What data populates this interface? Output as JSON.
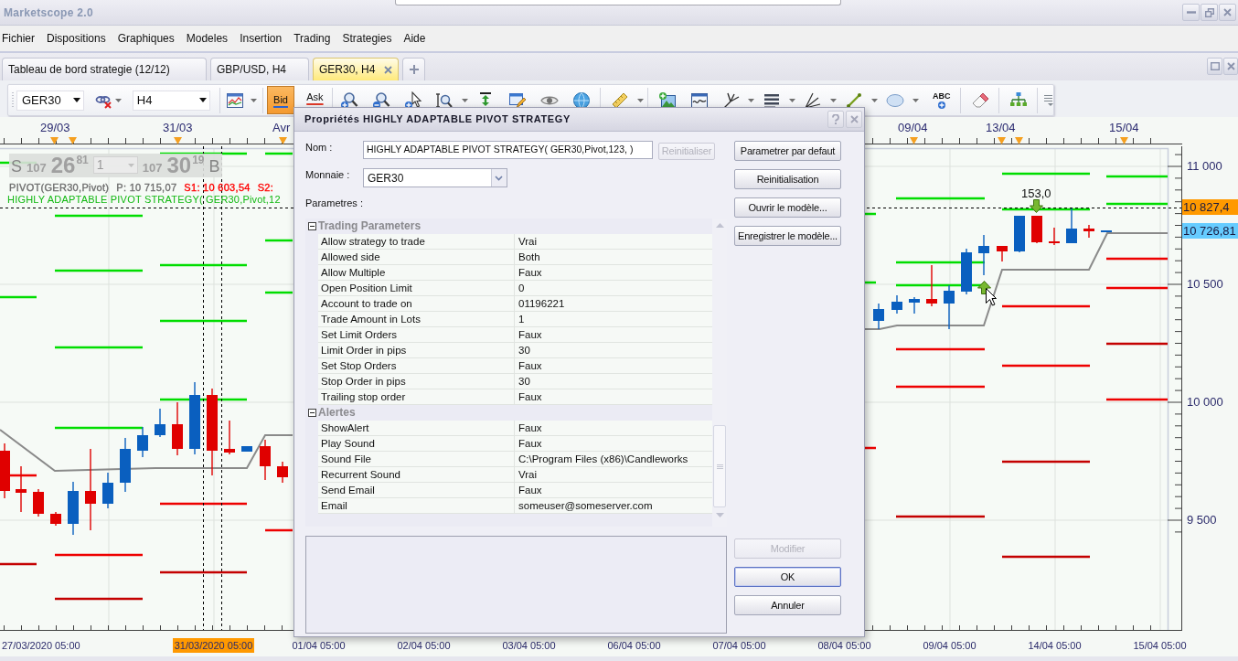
{
  "window": {
    "title": "Marketscope 2.0"
  },
  "menu": [
    "Fichier",
    "Dispositions",
    "Graphiques",
    "Modeles",
    "Insertion",
    "Trading",
    "Strategies",
    "Aide"
  ],
  "tabs": [
    {
      "label": "Tableau de bord strategie (12/12)",
      "selected": false
    },
    {
      "label": "GBP/USD, H4",
      "selected": false
    },
    {
      "label": "GER30, H4",
      "selected": true
    }
  ],
  "toolbar": {
    "instrument": "GER30",
    "timeframe": "H4",
    "price_modes": [
      {
        "label": "Bid",
        "selected": true
      },
      {
        "label": "Ask",
        "selected": false
      }
    ],
    "text_tool": "ABC"
  },
  "chart": {
    "top_axis": [
      "29/03",
      "31/03",
      "Avr",
      "09/04",
      "13/04",
      "15/04"
    ],
    "quote_panel": {
      "sell_side": "S",
      "sell_prefix": "107",
      "sell_main": "26",
      "sell_pips": "81",
      "amount": "1",
      "buy_prefix": "107",
      "buy_main": "30",
      "buy_pips": "19",
      "buy_side": "B"
    },
    "pivot_legend": [
      {
        "text": "PIVOT(GER30,Pivot)",
        "color": "#6e6e6e"
      },
      {
        "text": "P: 10 715,07",
        "color": "#6e6e6e"
      },
      {
        "text": "S1: 10 603,54",
        "color": "#ff0000"
      },
      {
        "text": "S2:",
        "color": "#ff0000"
      }
    ],
    "strategy_legend": "HIGHLY ADAPTABLE PIVOT STRATEGY( GER30,Pivot,12",
    "trade_label": "153,0",
    "price_labels": [
      "11 000",
      "10 500",
      "10 000",
      "9 500"
    ],
    "price_markers": [
      {
        "label": "10 827,4",
        "color": "#ff9900"
      },
      {
        "label": "10 726,81",
        "color": "#66ccff"
      }
    ],
    "bottom_axis": [
      {
        "label": "27/03/2020 05:00",
        "highlighted": false
      },
      {
        "label": "31/03/2020 05:00",
        "highlighted": true
      },
      {
        "label": "01/04 05:00",
        "highlighted": false
      },
      {
        "label": "02/04 05:00",
        "highlighted": false
      },
      {
        "label": "03/04 05:00",
        "highlighted": false
      },
      {
        "label": "06/04 05:00",
        "highlighted": false
      },
      {
        "label": "07/04 05:00",
        "highlighted": false
      },
      {
        "label": "08/04 05:00",
        "highlighted": false
      },
      {
        "label": "09/04 05:00",
        "highlighted": false
      },
      {
        "label": "14/04 05:00",
        "highlighted": false
      },
      {
        "label": "15/04 05:00",
        "highlighted": false
      }
    ]
  },
  "dialog": {
    "title": "Propriétés HIGHLY ADAPTABLE PIVOT STRATEGY",
    "name": {
      "label": "Nom :",
      "value": "HIGHLY ADAPTABLE PIVOT STRATEGY( GER30,Pivot,123, )"
    },
    "reset_button": {
      "label": "Reinitialiser",
      "disabled": true,
      "focused": false
    },
    "currency": {
      "label": "Monnaie :",
      "value": "GER30"
    },
    "parameters_label": "Parametres :",
    "groups": [
      {
        "title": "Trading Parameters",
        "expanded": true,
        "rows": [
          {
            "name": "Allow strategy to trade",
            "value": "Vrai"
          },
          {
            "name": "Allowed side",
            "value": "Both"
          },
          {
            "name": "Allow Multiple",
            "value": "Faux"
          },
          {
            "name": "Open Position Limit",
            "value": "0"
          },
          {
            "name": "Account to trade on",
            "value": "01196221"
          },
          {
            "name": "Trade Amount in Lots",
            "value": "1"
          },
          {
            "name": "Set Limit Orders",
            "value": "Faux"
          },
          {
            "name": "Limit Order in pips",
            "value": "30"
          },
          {
            "name": "Set Stop Orders",
            "value": "Faux"
          },
          {
            "name": "Stop Order in pips",
            "value": "30"
          },
          {
            "name": "Trailing stop order",
            "value": "Faux"
          }
        ]
      },
      {
        "title": "Alertes",
        "expanded": true,
        "rows": [
          {
            "name": "ShowAlert",
            "value": "Faux"
          },
          {
            "name": "Play Sound",
            "value": "Faux"
          },
          {
            "name": "Sound File",
            "value": "C:\\Program Files (x86)\\Candleworks"
          },
          {
            "name": "Recurrent Sound",
            "value": "Vrai"
          },
          {
            "name": "Send Email",
            "value": "Faux"
          },
          {
            "name": "Email",
            "value": "someuser@someserver.com"
          }
        ]
      }
    ],
    "side_buttons": [
      {
        "label": "Parametrer par defaut",
        "disabled": false,
        "focused": false
      },
      {
        "label": "Reinitialisation",
        "disabled": false,
        "focused": false
      },
      {
        "label": "Ouvrir le modèle...",
        "disabled": false,
        "focused": false
      },
      {
        "label": "Enregistrer le modèle...",
        "disabled": false,
        "focused": false
      }
    ],
    "action_buttons": [
      {
        "label": "Modifier",
        "disabled": true,
        "focused": false
      },
      {
        "label": "OK",
        "disabled": false,
        "focused": true
      },
      {
        "label": "Annuler",
        "disabled": false,
        "focused": false
      }
    ]
  }
}
